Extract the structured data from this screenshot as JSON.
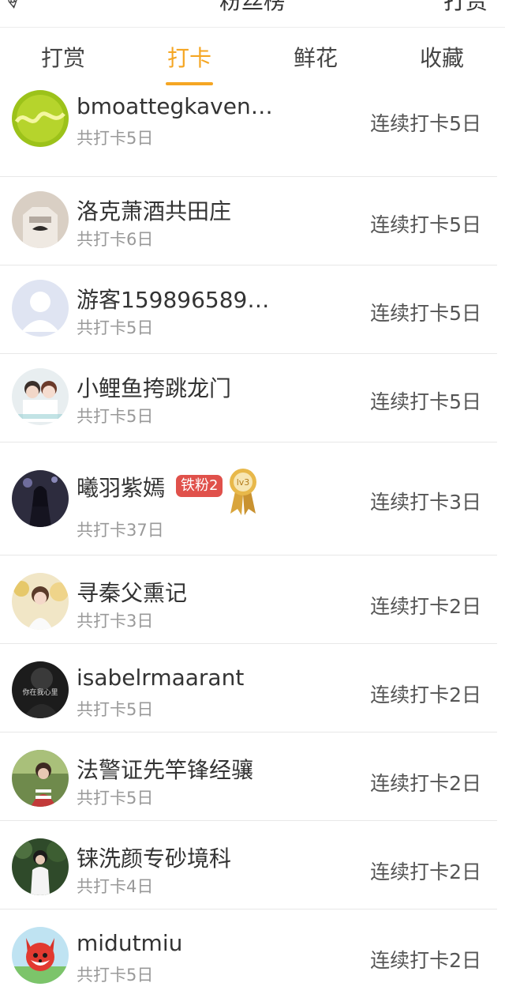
{
  "header": {
    "title": "粉丝榜",
    "right": "打赏"
  },
  "tabs": [
    {
      "label": "打赏",
      "active": false
    },
    {
      "label": "打卡",
      "active": true
    },
    {
      "label": "鲜花",
      "active": false
    },
    {
      "label": "收藏",
      "active": false
    }
  ],
  "list": [
    {
      "name": "bmoattegkaven…",
      "total": "共打卡5日",
      "streak": "连续打卡5日",
      "avatar": "yellow-green-abstract"
    },
    {
      "name": "洛克萧酒共田庄",
      "total": "共打卡6日",
      "streak": "连续打卡5日",
      "avatar": "bonjour-tshirt"
    },
    {
      "name": "游客159896589…",
      "total": "共打卡5日",
      "streak": "连续打卡5日",
      "avatar": "default-silhouette"
    },
    {
      "name": "小鲤鱼挎跳龙门",
      "total": "共打卡5日",
      "streak": "连续打卡5日",
      "avatar": "couple-photo"
    },
    {
      "name": "曦羽紫嫣",
      "total": "共打卡37日",
      "streak": "连续打卡3日",
      "avatar": "anime-girl",
      "fan_badge": "铁粉2",
      "level_badge": "lv3"
    },
    {
      "name": "寻秦父熏记",
      "total": "共打卡3日",
      "streak": "连续打卡2日",
      "avatar": "girl-flowers"
    },
    {
      "name": "isabelrmaarant",
      "total": "共打卡5日",
      "streak": "连续打卡2日",
      "avatar": "dark-portrait",
      "avatar_text": "你在我心里"
    },
    {
      "name": "法警证先竿锋经骧",
      "total": "共打卡5日",
      "streak": "连续打卡2日",
      "avatar": "outdoor-photo"
    },
    {
      "name": "铼洗颜专砂境科",
      "total": "共打卡4日",
      "streak": "连续打卡2日",
      "avatar": "person-in-park"
    },
    {
      "name": "midutmiu",
      "total": "共打卡5日",
      "streak": "连续打卡2日",
      "avatar": "red-fox-cartoon"
    }
  ]
}
